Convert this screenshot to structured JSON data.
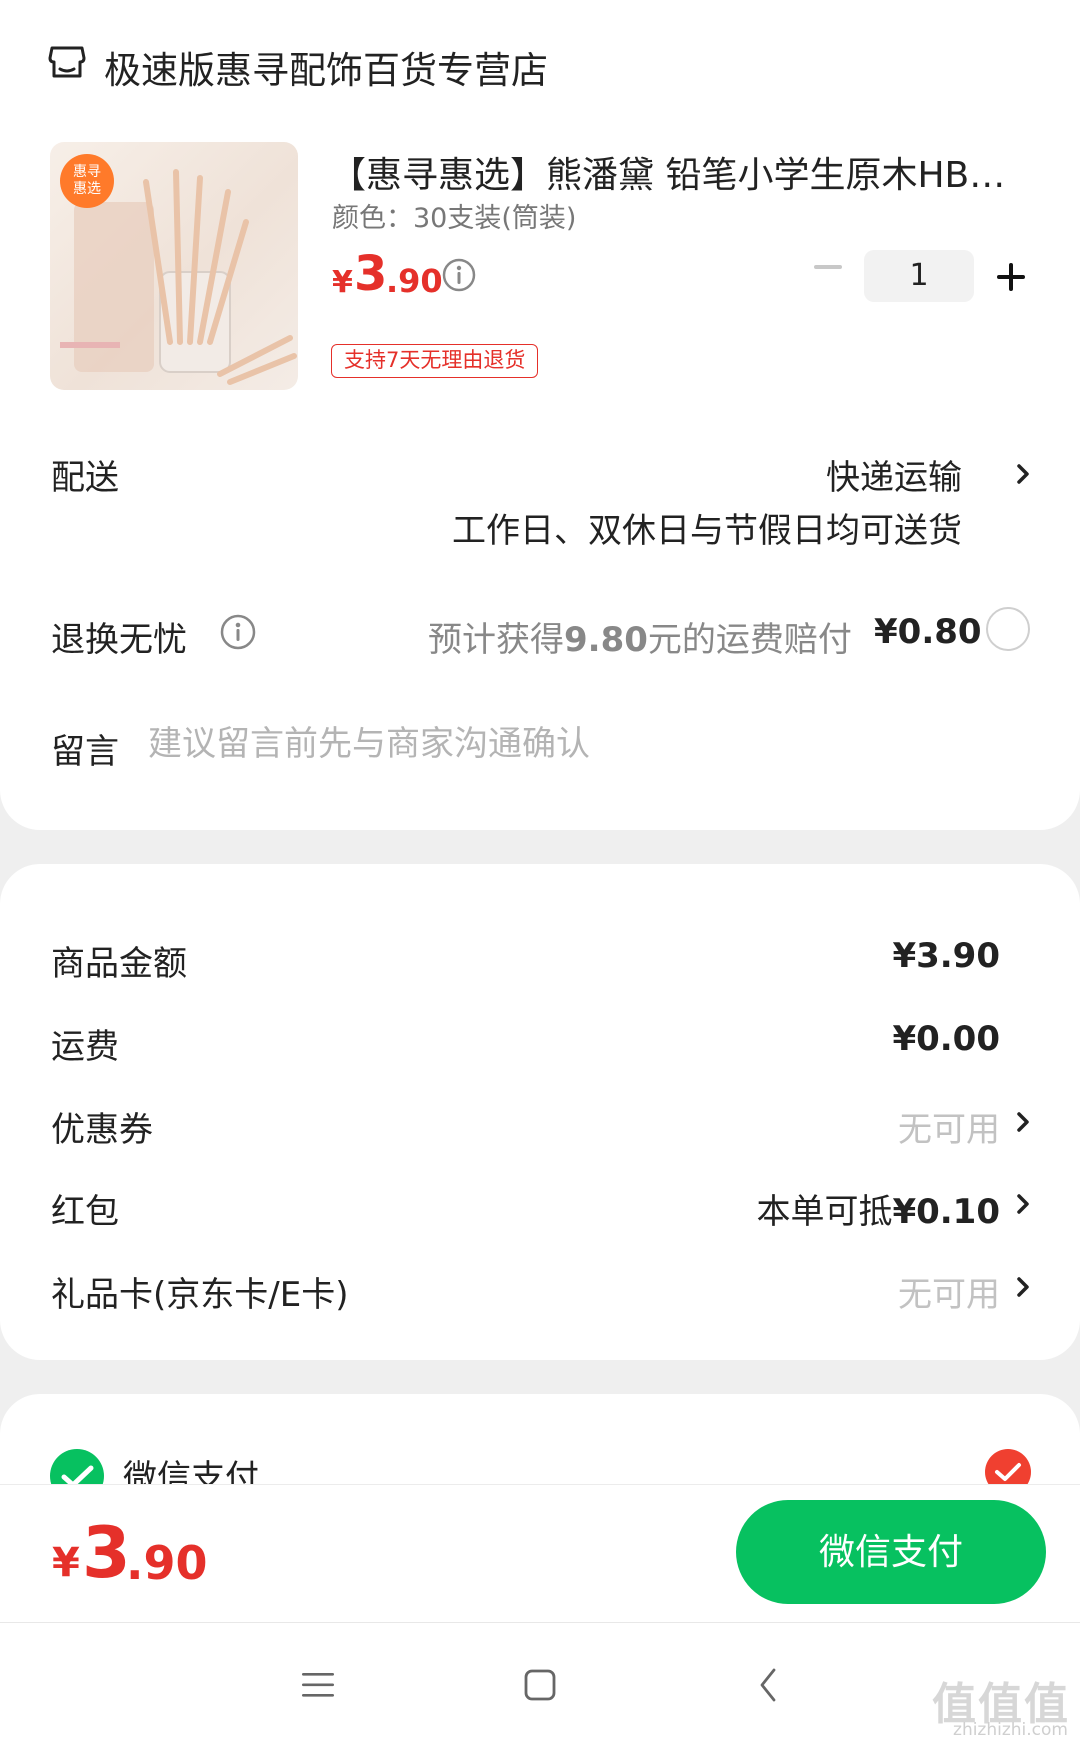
{
  "store": {
    "name": "极速版惠寻配饰百货专营店",
    "icon": "store-icon"
  },
  "product": {
    "badge": "惠寻\n惠选",
    "title": "【惠寻惠选】熊潘黛 铅笔小学生原木HB三...",
    "spec": "颜色：30支装(筒装)",
    "price_symbol": "¥",
    "price_int": "3",
    "price_dec": ".90",
    "quantity": "1",
    "return_policy": "支持7天无理由退货"
  },
  "delivery": {
    "label": "配送",
    "method": "快递运输",
    "note": "工作日、双休日与节假日均可送货"
  },
  "returns": {
    "label": "退换无忧",
    "desc_prefix": "预计获得",
    "desc_amount": "9.80",
    "desc_suffix": "元的运费赔付",
    "price": "¥0.80"
  },
  "message": {
    "label": "留言",
    "placeholder": "建议留言前先与商家沟通确认"
  },
  "summary": {
    "goods_label": "商品金额",
    "goods_value": "¥3.90",
    "shipping_label": "运费",
    "shipping_value": "¥0.00",
    "coupon_label": "优惠券",
    "coupon_value": "无可用",
    "redpacket_label": "红包",
    "redpacket_prefix": "本单可抵",
    "redpacket_amount": "¥0.10",
    "giftcard_label": "礼品卡(京东卡/E卡)",
    "giftcard_value": "无可用"
  },
  "payment": {
    "method_label": "微信支付",
    "selected": true
  },
  "footer": {
    "total_symbol": "¥",
    "total_int": "3",
    "total_dec": ".90",
    "pay_button": "微信支付"
  },
  "watermark": {
    "text": "值值值",
    "sub": "zhizhizhi.com"
  },
  "colors": {
    "accent_red": "#e5302a",
    "wechat_green": "#07c160",
    "selected_check": "#f04030"
  }
}
